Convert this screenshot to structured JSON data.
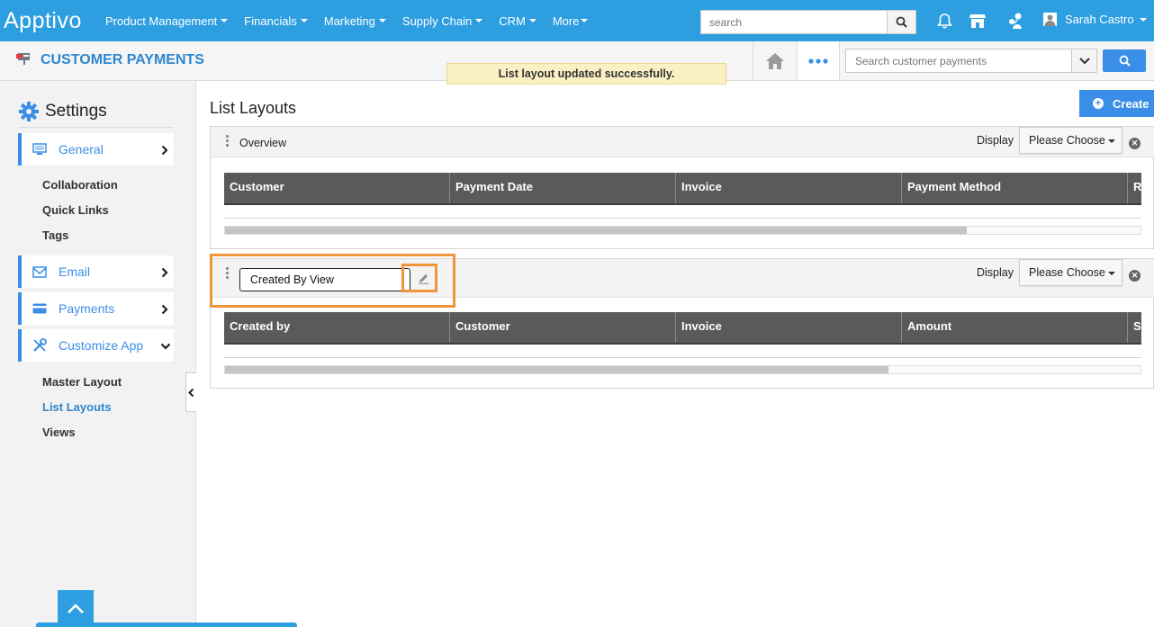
{
  "app": {
    "logo": "Apptivo"
  },
  "nav": {
    "items": [
      {
        "label": "Product Management"
      },
      {
        "label": "Financials"
      },
      {
        "label": "Marketing"
      },
      {
        "label": "Supply Chain"
      },
      {
        "label": "CRM"
      },
      {
        "label": "More"
      }
    ],
    "search_placeholder": "search",
    "user_name": "Sarah Castro"
  },
  "subheader": {
    "title": "CUSTOMER PAYMENTS",
    "toast": "List layout updated successfully.",
    "search_placeholder": "Search customer payments"
  },
  "sidebar": {
    "heading": "Settings",
    "sections": [
      {
        "label": "General",
        "icon": "monitor-icon",
        "expanded": false
      },
      {
        "label": "Email",
        "icon": "envelope-icon",
        "expanded": false
      },
      {
        "label": "Payments",
        "icon": "credit-card-icon",
        "expanded": false
      },
      {
        "label": "Customize App",
        "icon": "tools-icon",
        "expanded": true
      }
    ],
    "general_links": [
      "Collaboration",
      "Quick Links",
      "Tags"
    ],
    "customize_links": [
      "Master Layout",
      "List Layouts",
      "Views"
    ],
    "active_link": "List Layouts"
  },
  "main": {
    "title": "List Layouts",
    "create_label": "Create",
    "panels": [
      {
        "name": "Overview",
        "display_label": "Display",
        "display_value": "Please Choose",
        "columns": [
          "Customer",
          "Payment Date",
          "Invoice",
          "Payment Method",
          "R"
        ],
        "scroll_fraction": 0.81
      },
      {
        "name": "Created By View",
        "editing": true,
        "display_label": "Display",
        "display_value": "Please Choose",
        "columns": [
          "Created by",
          "Customer",
          "Invoice",
          "Amount",
          "S"
        ],
        "scroll_fraction": 0.725
      }
    ]
  },
  "colors": {
    "brand": "#2d9fe0",
    "accent": "#3b8ee8",
    "highlight": "#f0943a",
    "toast_bg": "#fbf0c4"
  }
}
